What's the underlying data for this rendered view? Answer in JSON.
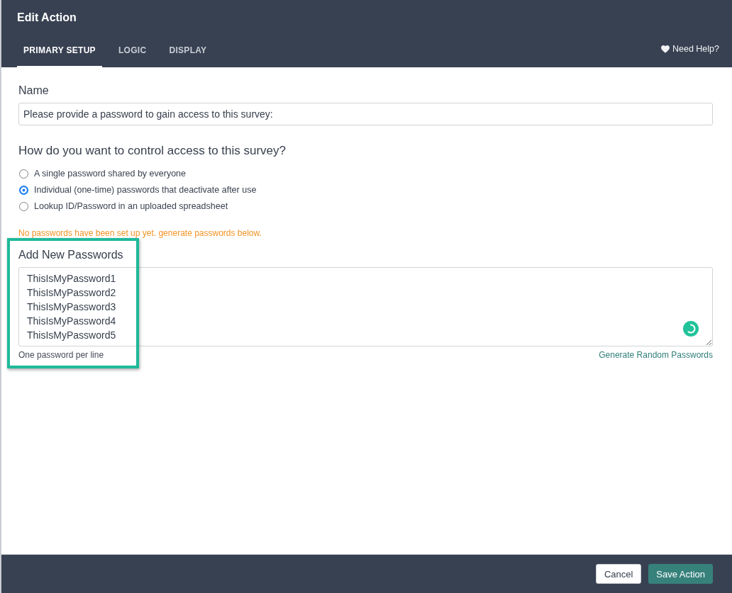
{
  "window": {
    "title": "Edit Action"
  },
  "tabs": [
    {
      "label": "PRIMARY SETUP",
      "selected": true
    },
    {
      "label": "LOGIC",
      "selected": false
    },
    {
      "label": "DISPLAY",
      "selected": false
    }
  ],
  "help_link": "Need Help?",
  "name_field": {
    "label": "Name",
    "value": "Please provide a password to gain access to this survey:"
  },
  "access": {
    "question": "How do you want to control access to this survey?",
    "options": [
      {
        "label": "A single password shared by everyone",
        "selected": false
      },
      {
        "label": "Individual (one-time) passwords that deactivate after use",
        "selected": true
      },
      {
        "label": "Lookup ID/Password in an uploaded spreadsheet",
        "selected": false
      }
    ]
  },
  "warning": "No passwords have been set up yet. generate passwords below.",
  "passwords": {
    "label": "Add New Passwords",
    "lines": [
      "ThisIsMyPassword1",
      "ThisIsMyPassword2",
      "ThisIsMyPassword3",
      "ThisIsMyPassword4",
      "ThisIsMyPassword5"
    ],
    "hint": "One password per line",
    "highlighted": true,
    "loading": true
  },
  "generate_link": "Generate Random Passwords",
  "buttons": [
    {
      "label": "Cancel",
      "kind": "secondary"
    },
    {
      "label": "Save Action",
      "kind": "primary"
    }
  ]
}
